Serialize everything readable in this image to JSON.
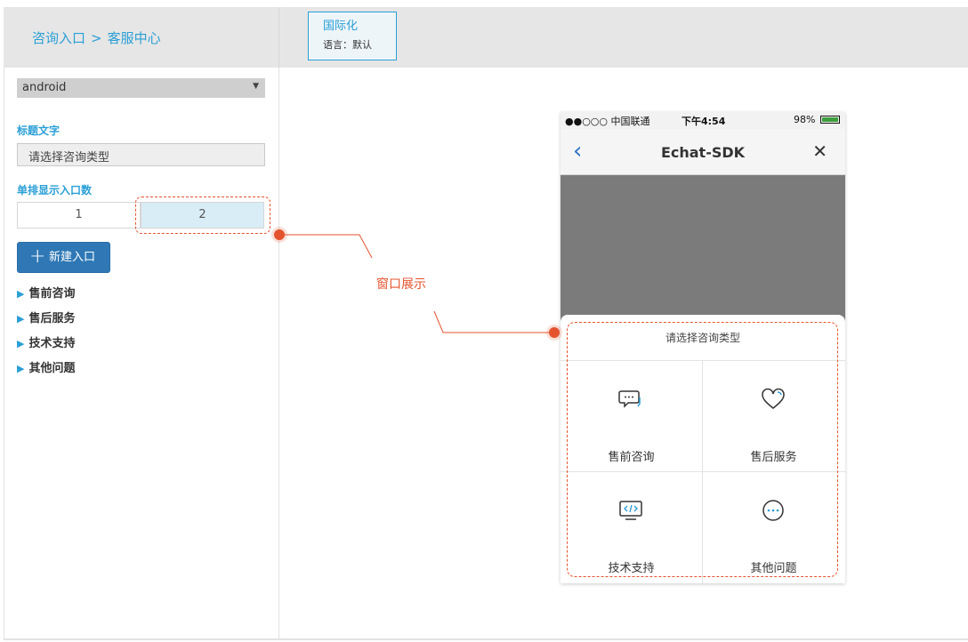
{
  "header": {
    "breadcrumb_root": "咨询入口",
    "breadcrumb_sep": ">",
    "breadcrumb_current": "客服中心",
    "i18n_title": "国际化",
    "i18n_lang": "语言：默认"
  },
  "sidebar": {
    "platform_value": "android",
    "platform_arrow": "▼",
    "title_label": "标题文字",
    "title_input_value": "请选择咨询类型",
    "count_label": "单排显示入口数",
    "count_options": [
      "1",
      "2"
    ],
    "count_selected": "2",
    "new_entry_label": "新建入口",
    "new_entry_icon": "plus-icon",
    "tree_items": [
      "售前咨询",
      "售后服务",
      "技术支持",
      "其他问题"
    ],
    "tree_icon": "triangle-right-icon"
  },
  "annotation": {
    "text": "窗口展示",
    "color": "#e4532e"
  },
  "phone": {
    "status_carrier": "●●○○○ 中国联通",
    "status_time": "下午4:54",
    "status_battery": "98%",
    "nav_title": "Echat-SDK",
    "nav_back_icon": "chevron-left-icon",
    "nav_close_icon": "close-icon",
    "sheet_title": "请选择咨询类型",
    "entries": [
      {
        "label": "售前咨询",
        "icon": "chat-bubbles-icon"
      },
      {
        "label": "售后服务",
        "icon": "heart-icon"
      },
      {
        "label": "技术支持",
        "icon": "code-monitor-icon"
      },
      {
        "label": "其他问题",
        "icon": "more-circle-icon"
      }
    ]
  },
  "colors": {
    "accent": "#2a9fd6",
    "primary_button": "#2f78b5",
    "selected_option": "#d9edf7",
    "annotation": "#e4532e"
  }
}
